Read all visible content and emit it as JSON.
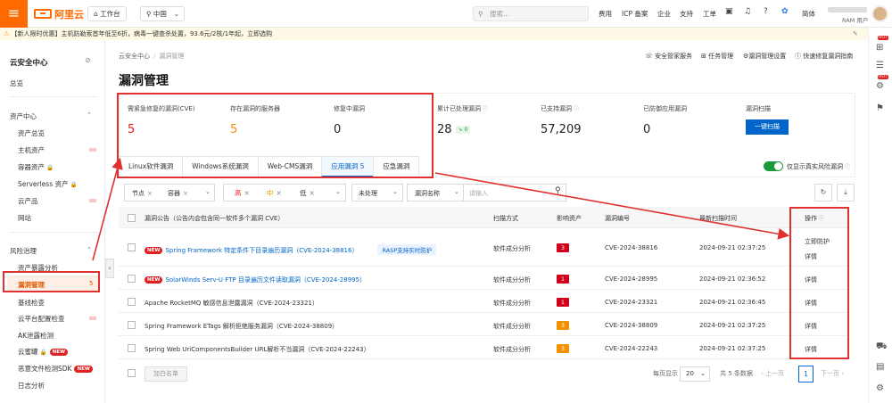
{
  "topbar": {
    "workbench": "工作台",
    "region": "中国",
    "search_placeholder": "搜索...",
    "links": [
      "费用",
      "ICP 备案",
      "企业",
      "支持",
      "工单"
    ],
    "lang": "简体",
    "user_role": "RAM 用户",
    "logo_text": "阿里云"
  },
  "notice": {
    "text": "【新人限时优惠】主机防勒索首年低至6折，病毒一键查杀处置，93.6元/2核/1年起，立即选购"
  },
  "sidebar": {
    "title": "云安全中心",
    "overview": "总览",
    "groups": [
      {
        "label": "资产中心",
        "items": [
          "资产总览",
          "主机资产",
          "容器资产",
          "Serverless 资产",
          "云产品",
          "网站"
        ]
      },
      {
        "label": "风险治理",
        "items": [
          "资产暴露分析",
          "漏洞管理",
          "基线检查",
          "云平台配置检查",
          "AK泄露检测",
          "云蜜罐",
          "恶意文件检测SDK",
          "日志分析"
        ]
      }
    ],
    "active_count": "5"
  },
  "breadcrumb": {
    "root": "云安全中心",
    "current": "漏洞管理"
  },
  "actions": [
    "安全管家服务",
    "任务管理",
    "漏洞管理设置",
    "快速修复漏洞指南"
  ],
  "page_title": "漏洞管理",
  "stats": [
    {
      "label": "需紧急修复的漏洞(CVE)",
      "value": "5",
      "color": "#e02020"
    },
    {
      "label": "存在漏洞的服务器",
      "value": "5",
      "color": "#f39000"
    },
    {
      "label": "修复中漏洞",
      "value": "0",
      "color": "#222"
    },
    {
      "label": "累计已处理漏洞",
      "value": "28",
      "color": "#222",
      "badge": "0"
    },
    {
      "label": "已支持漏洞",
      "value": "57,209",
      "color": "#222"
    },
    {
      "label": "已防御应用漏洞",
      "value": "0",
      "color": "#222"
    },
    {
      "label": "漏洞扫描",
      "button": "一键扫描"
    }
  ],
  "tabs": [
    "Linux软件漏洞",
    "Windows系统漏洞",
    "Web-CMS漏洞",
    "应用漏洞 5",
    "应急漏洞"
  ],
  "toggle_label": "仅显示真实风险漏洞",
  "filters": {
    "tags": [
      "节点",
      "容器"
    ],
    "priorities": [
      {
        "label": "高",
        "color": "#e02020"
      },
      {
        "label": "中",
        "color": "#f39000"
      },
      {
        "label": "低",
        "color": "#333"
      }
    ],
    "status": "未处理",
    "name_select": "漏洞名称",
    "input_placeholder": "请输入"
  },
  "table": {
    "headers": [
      "漏洞公告（公告内会包含同一软件多个漏洞 CVE）",
      "扫描方式",
      "影响资产",
      "漏洞编号",
      "最新扫描时间",
      "操作"
    ],
    "rows": [
      {
        "new": true,
        "name": "Spring Framework 特定条件下目录遍历漏洞（CVE-2024-38816）",
        "rasp": "RASP支持实时防护",
        "method": "软件成分分析",
        "count": "3",
        "sev": "high",
        "cve": "CVE-2024-38816",
        "time": "2024-09-21 02:37:25",
        "ops": [
          "立即防护",
          "详情"
        ]
      },
      {
        "new": true,
        "name": "SolarWinds Serv-U FTP 目录遍历文件读取漏洞（CVE-2024-28995）",
        "method": "软件成分分析",
        "count": "1",
        "sev": "high",
        "cve": "CVE-2024-28995",
        "time": "2024-09-21 02:36:52",
        "ops": [
          "详情"
        ]
      },
      {
        "new": false,
        "name": "Apache RocketMQ 敏感信息泄露漏洞（CVE-2024-23321）",
        "method": "软件成分分析",
        "count": "1",
        "sev": "high",
        "cve": "CVE-2024-23321",
        "time": "2024-09-21 02:36:45",
        "ops": [
          "详情"
        ]
      },
      {
        "new": false,
        "name": "Spring Framework ETags 解析拒绝服务漏洞（CVE-2024-38809）",
        "method": "软件成分分析",
        "count": "3",
        "sev": "mid",
        "cve": "CVE-2024-38809",
        "time": "2024-09-21 02:37:25",
        "ops": [
          "详情"
        ]
      },
      {
        "new": false,
        "name": "Spring Web UriComponentsBuilder URL解析不当漏洞（CVE-2024-22243）",
        "method": "软件成分分析",
        "count": "3",
        "sev": "mid",
        "cve": "CVE-2024-22243",
        "time": "2024-09-21 02:37:25",
        "ops": [
          "详情"
        ]
      }
    ]
  },
  "footer": {
    "batch": "加白名单",
    "per_page_label": "每页显示",
    "per_page": "20",
    "total": "共 5 条数据",
    "prev": "上一页",
    "page": "1",
    "next": "下一页"
  },
  "new_badge": "NEW",
  "hot_badge": "HOT"
}
